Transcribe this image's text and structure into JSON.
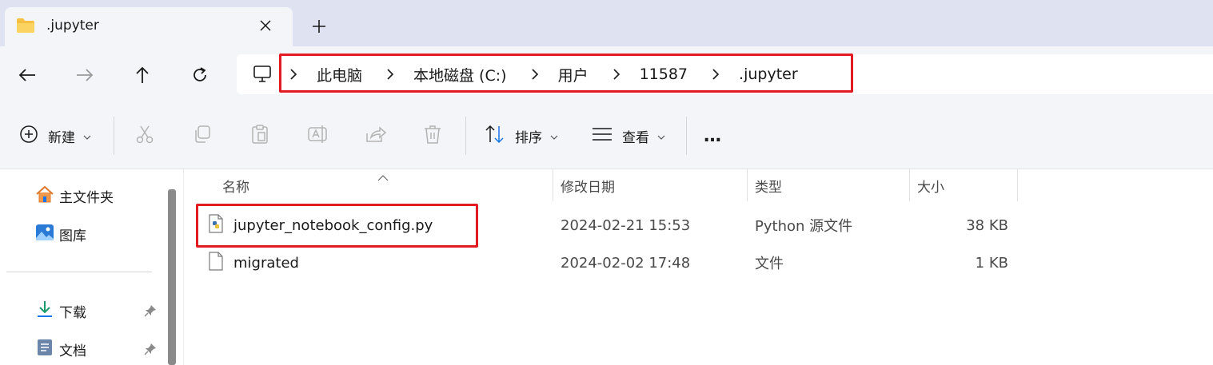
{
  "window": {
    "tab_title": ".jupyter",
    "new_tab": "+"
  },
  "address": {
    "crumbs": [
      "此电脑",
      "本地磁盘 (C:)",
      "用户",
      "11587",
      ".jupyter"
    ]
  },
  "toolbar": {
    "new_label": "新建",
    "sort_label": "排序",
    "view_label": "查看",
    "more_label": "…"
  },
  "sidebar": {
    "items": [
      {
        "label": "主文件夹",
        "icon": "home-icon"
      },
      {
        "label": "图库",
        "icon": "gallery-icon"
      },
      {
        "label": "下载",
        "icon": "download-icon",
        "pinned": true
      },
      {
        "label": "文档",
        "icon": "document-icon",
        "pinned": true
      }
    ]
  },
  "columns": {
    "name": "名称",
    "date": "修改日期",
    "type": "类型",
    "size": "大小"
  },
  "files": [
    {
      "name": "jupyter_notebook_config.py",
      "date": "2024-02-21 15:53",
      "type": "Python 源文件",
      "size": "38 KB",
      "icon": "python-file-icon",
      "highlighted": true
    },
    {
      "name": "migrated",
      "date": "2024-02-02 17:48",
      "type": "文件",
      "size": "1 KB",
      "icon": "file-icon",
      "highlighted": false
    }
  ],
  "colors": {
    "highlight": "#e21b23",
    "tabstrip": "#dfe3f1",
    "toolbar_bg": "#f4f5f9",
    "folder": "#f6c143",
    "accent": "#1a73e8"
  }
}
